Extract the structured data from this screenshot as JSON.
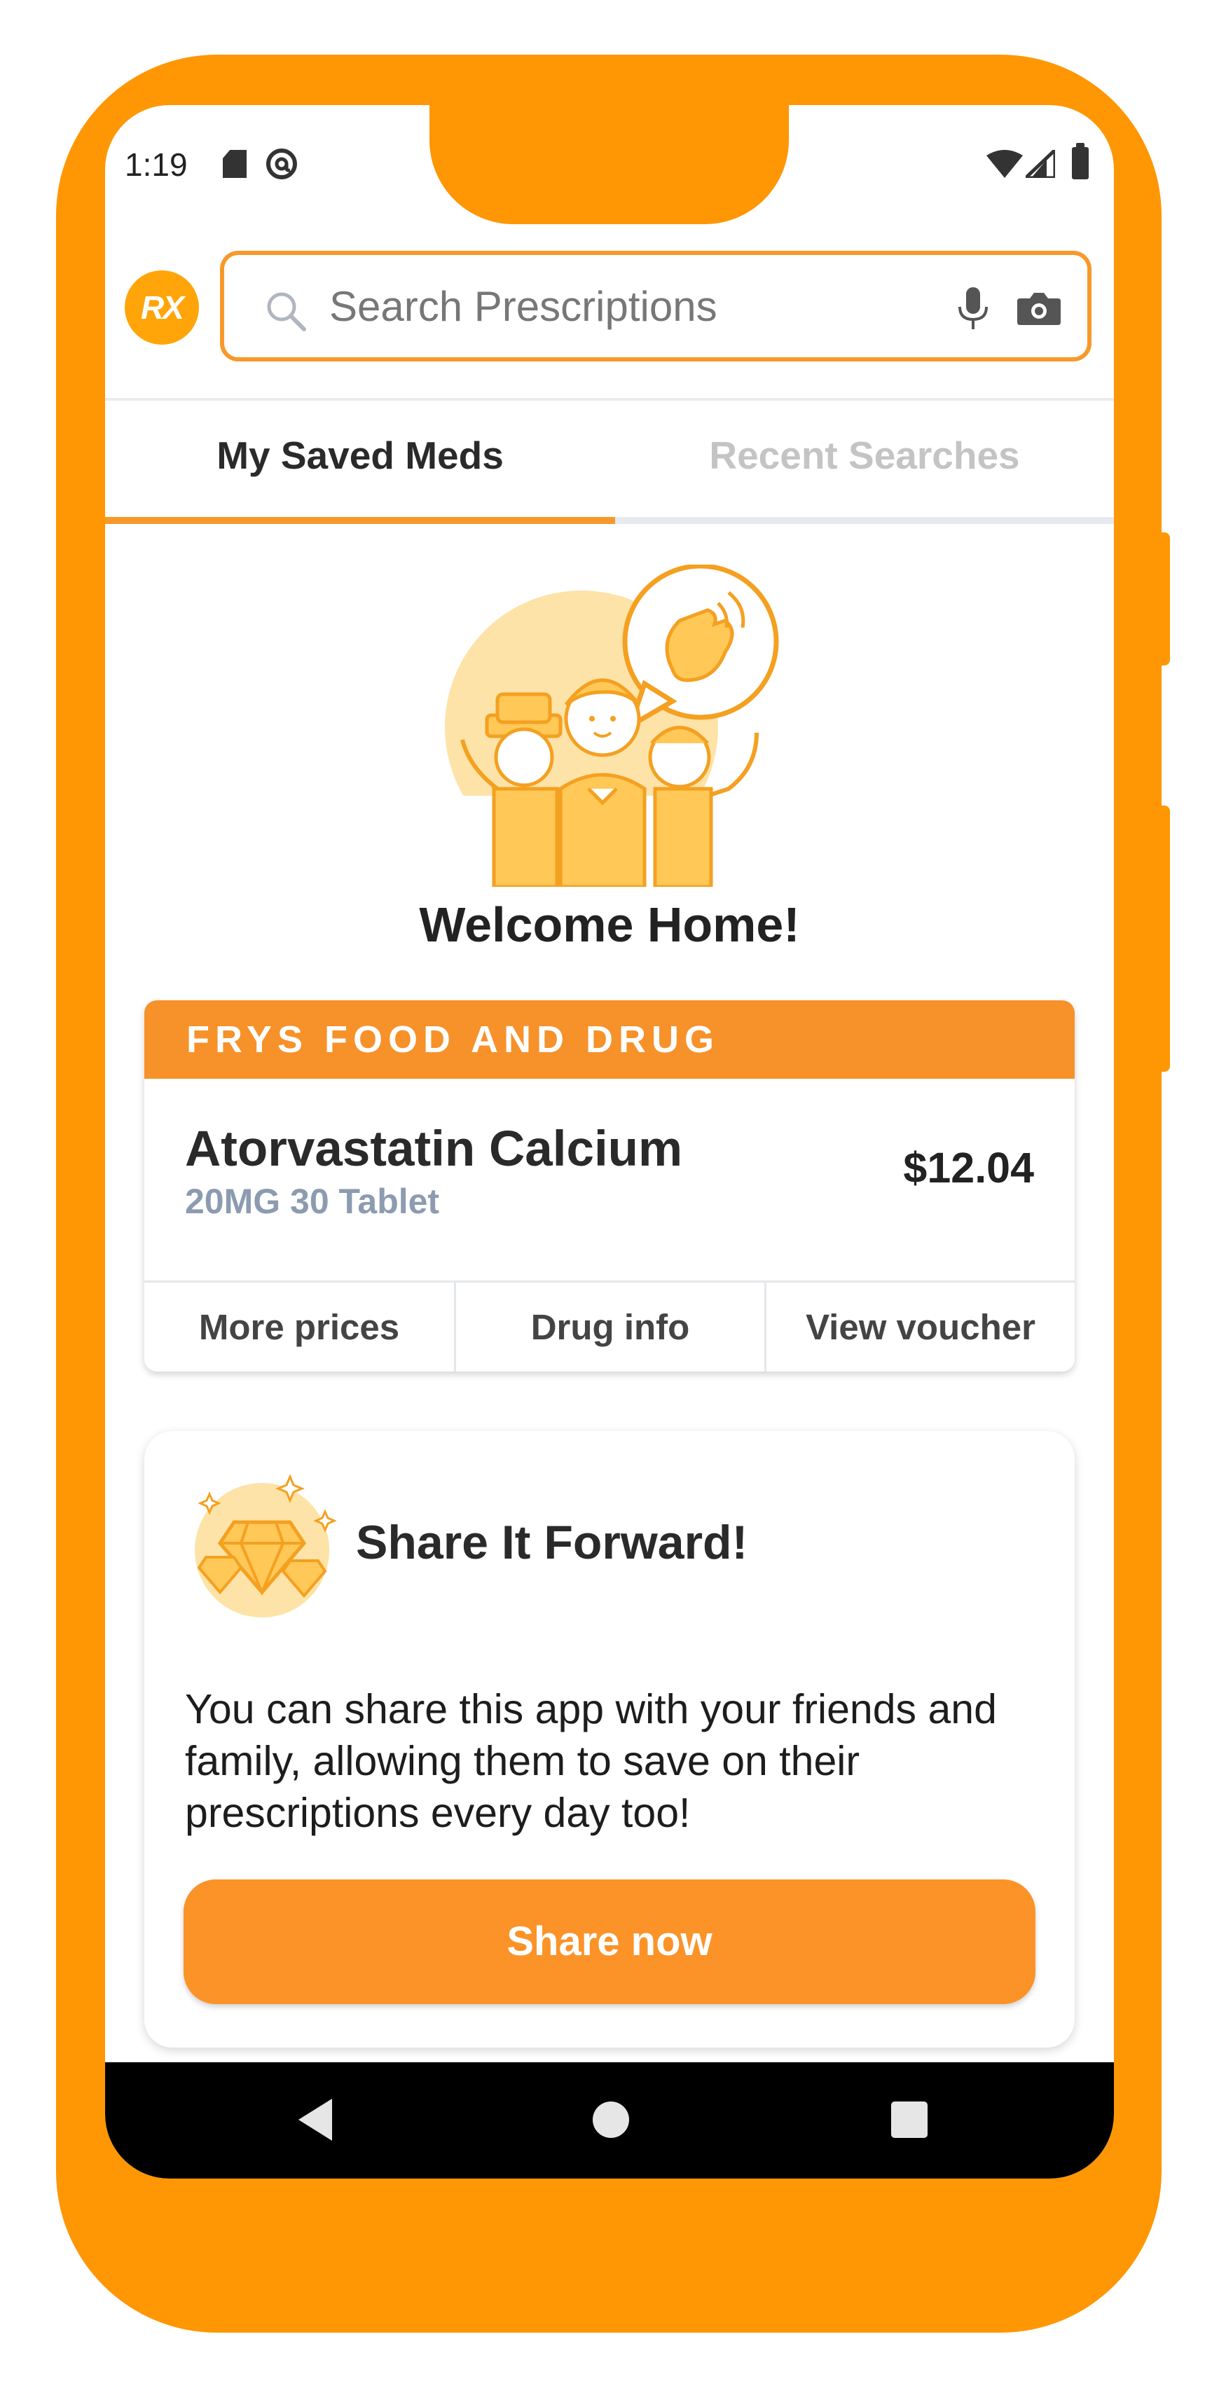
{
  "status_bar": {
    "time": "1:19"
  },
  "header": {
    "logo_text": "RX",
    "search": {
      "placeholder": "Search Prescriptions",
      "value": ""
    }
  },
  "tabs": [
    {
      "label": "My Saved Meds",
      "active": true
    },
    {
      "label": "Recent Searches",
      "active": false
    }
  ],
  "welcome": {
    "title": "Welcome Home!"
  },
  "saved_med": {
    "pharmacy": "FRYS FOOD AND DRUG",
    "drug_name": "Atorvastatin Calcium",
    "dosage": "20MG 30 Tablet",
    "price": "$12.04",
    "actions": [
      "More prices",
      "Drug info",
      "View voucher"
    ]
  },
  "share": {
    "title": "Share It Forward!",
    "text": "You can share this app with your friends and family, allowing them to save on their prescriptions every day too!",
    "button_label": "Share now"
  },
  "colors": {
    "accent": "#ff9603",
    "header_bar": "#f7912a",
    "button": "#fb9328",
    "dose_text": "#8c9bb0"
  },
  "icons": [
    "sd-card-icon",
    "at-sign-icon",
    "wifi-icon",
    "signal-icon",
    "battery-icon",
    "search-icon",
    "mic-icon",
    "camera-icon",
    "nav-back-icon",
    "nav-home-icon",
    "nav-recent-icon"
  ]
}
